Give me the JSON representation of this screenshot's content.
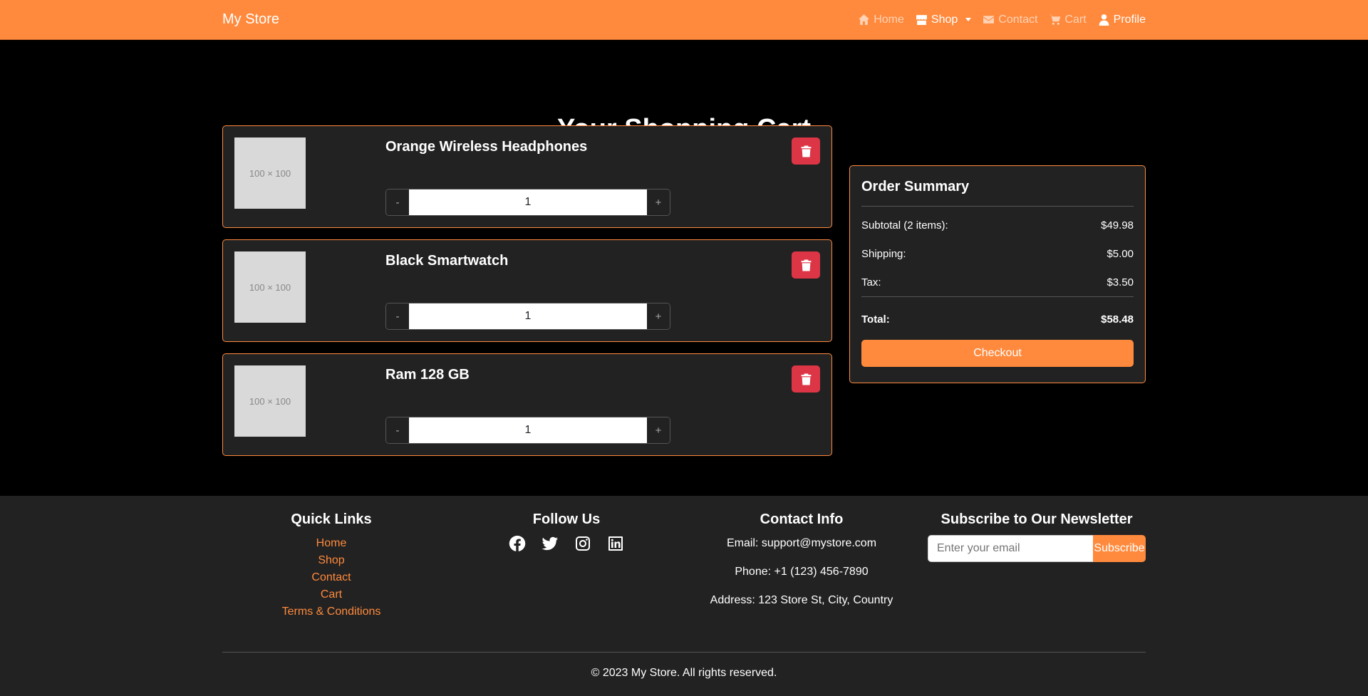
{
  "nav": {
    "brand": "My Store",
    "links": [
      {
        "label": "Home",
        "icon": "home-icon"
      },
      {
        "label": "Shop",
        "icon": "store-icon"
      },
      {
        "label": "Contact",
        "icon": "envelope-icon"
      },
      {
        "label": "Cart",
        "icon": "cart-icon"
      },
      {
        "label": "Profile",
        "icon": "user-icon"
      }
    ]
  },
  "page": {
    "title": "Your Shopping Cart"
  },
  "cart": {
    "items": [
      {
        "name": "Orange Wireless Headphones",
        "image": "100 × 100",
        "quantity": "1",
        "minus": "-",
        "plus": "+"
      },
      {
        "name": "Black Smartwatch",
        "image": "100 × 100",
        "quantity": "1",
        "minus": "-",
        "plus": "+"
      },
      {
        "name": "Ram 128 GB",
        "image": "100 × 100",
        "quantity": "1",
        "minus": "-",
        "plus": "+"
      }
    ]
  },
  "summary": {
    "title": "Order Summary",
    "subtotal_label": "Subtotal (2 items):",
    "subtotal_value": "$49.98",
    "shipping_label": "Shipping:",
    "shipping_value": "$5.00",
    "tax_label": "Tax:",
    "tax_value": "$3.50",
    "total_label": "Total:",
    "total_value": "$58.48",
    "checkout_label": "Checkout"
  },
  "footer": {
    "quick_links_title": "Quick Links",
    "quick_links": [
      "Home",
      "Shop",
      "Contact",
      "Cart",
      "Terms & Conditions"
    ],
    "follow_title": "Follow Us",
    "social_icons": [
      "facebook-icon",
      "twitter-icon",
      "instagram-icon",
      "linkedin-icon"
    ],
    "contact_title": "Contact Info",
    "email": "Email: support@mystore.com",
    "phone": "Phone: +1 (123) 456-7890",
    "address": "Address: 123 Store St, City, Country",
    "newsletter_title": "Subscribe to Our Newsletter",
    "newsletter_placeholder": "Enter your email",
    "subscribe_label": "Subscribe",
    "copyright": "© 2023 My Store. All rights reserved."
  },
  "colors": {
    "accent": "#ff8a3d",
    "danger": "#dc3545",
    "card": "#222222",
    "background": "#000000"
  }
}
